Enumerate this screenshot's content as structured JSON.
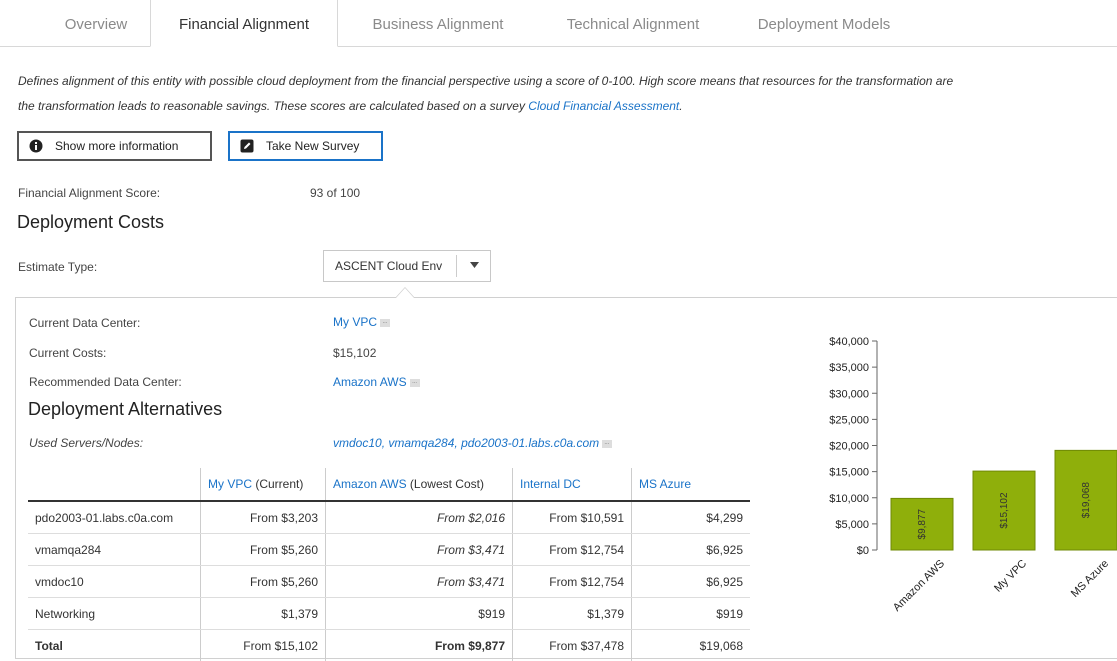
{
  "tabs": [
    "Overview",
    "Financial Alignment",
    "Business Alignment",
    "Technical Alignment",
    "Deployment Models"
  ],
  "description": {
    "line1": "Defines alignment of this entity with possible cloud deployment from the financial perspective using a score of 0-100. High score means that resources for the transformation are",
    "line2": "the transformation leads to reasonable savings. These scores are calculated based on a survey",
    "link": "Cloud Financial Assessment",
    "line2_end": "."
  },
  "buttons": {
    "show_more": "Show more information",
    "take_survey": "Take New Survey"
  },
  "score": {
    "label": "Financial Alignment Score:",
    "value": "93 of 100"
  },
  "deployment_costs": {
    "title": "Deployment Costs",
    "estimate_label": "Estimate Type:",
    "estimate_value": "ASCENT Cloud Env"
  },
  "details": {
    "current_dc_label": "Current Data Center:",
    "current_dc_value": "My VPC",
    "current_costs_label": "Current Costs:",
    "current_costs_value": "$15,102",
    "recommended_label": "Recommended Data Center:",
    "recommended_value": "Amazon AWS",
    "more_glyph": "..."
  },
  "alternatives": {
    "title": "Deployment Alternatives",
    "used_label": "Used Servers/Nodes:",
    "used_value": "vmdoc10, vmamqa284, pdo2003-01.labs.c0a.com",
    "headers": [
      {
        "name": "My VPC",
        "note": " (Current)"
      },
      {
        "name": "Amazon AWS",
        "note": " (Lowest Cost)"
      },
      {
        "name": "Internal DC",
        "note": ""
      },
      {
        "name": "MS Azure",
        "note": ""
      }
    ],
    "rows": [
      {
        "name": "pdo2003-01.labs.c0a.com",
        "link": true,
        "cells": [
          "From $3,203",
          "From $2,016",
          "From $10,591",
          "$4,299"
        ]
      },
      {
        "name": "vmamqa284",
        "link": true,
        "cells": [
          "From $5,260",
          "From $3,471",
          "From $12,754",
          "$6,925"
        ]
      },
      {
        "name": "vmdoc10",
        "link": true,
        "cells": [
          "From $5,260",
          "From $3,471",
          "From $12,754",
          "$6,925"
        ]
      },
      {
        "name": "Networking",
        "link": false,
        "cells": [
          "$1,379",
          "$919",
          "$1,379",
          "$919"
        ]
      },
      {
        "name": "Total",
        "link": false,
        "cells": [
          "From $15,102",
          "From $9,877",
          "From $37,478",
          "$19,068"
        ]
      }
    ]
  },
  "colors": {
    "accent": "#1a73c8",
    "bar": "#8faf0b",
    "text": "#333333"
  },
  "chart_data": {
    "type": "bar",
    "categories": [
      "Amazon AWS",
      "My VPC",
      "MS Azure"
    ],
    "values": [
      9877,
      15102,
      19068
    ],
    "data_labels": [
      "$9,877",
      "$15,102",
      "$19,068"
    ],
    "yticks": [
      "$0",
      "$5,000",
      "$10,000",
      "$15,000",
      "$20,000",
      "$25,000",
      "$30,000",
      "$35,000",
      "$40,000"
    ],
    "ylim": [
      0,
      40000
    ],
    "color": "#8faf0b"
  }
}
